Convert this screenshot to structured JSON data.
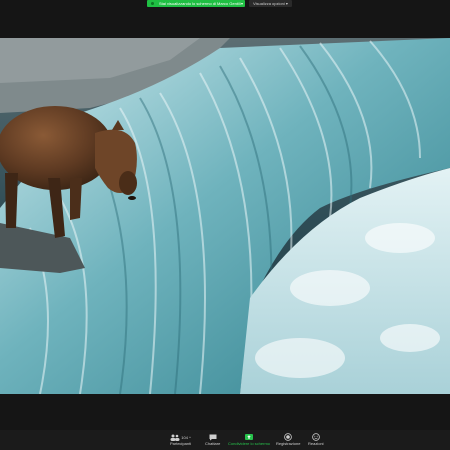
{
  "banner": {
    "share_status": "Stai visualizzando lo schermo di Marco Gentili",
    "view_options": "Visualizza opzioni"
  },
  "toolbar": {
    "participants_label": "Partecipanti",
    "participants_count": "104",
    "chat_label": "Chattare",
    "share_label": "Condividere lo schermo",
    "record_label": "Registrazione",
    "reactions_label": "Reazioni"
  },
  "colors": {
    "banner_green": "#1fbf43",
    "toolbar_bg": "#1b1b1b",
    "share_green": "#27c24c"
  },
  "shared_content": {
    "description_icon": "photo-bear-waterfall"
  }
}
